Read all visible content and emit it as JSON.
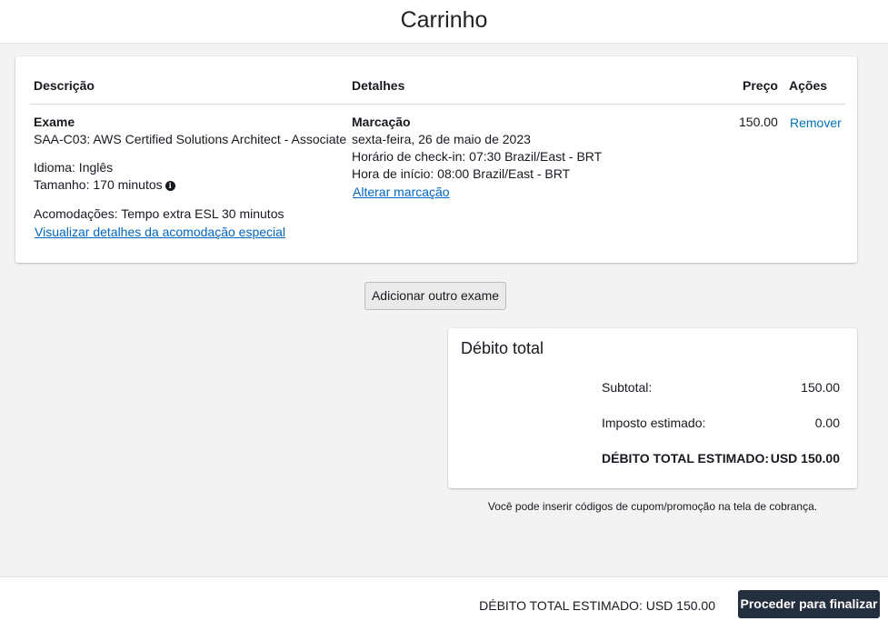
{
  "page": {
    "title": "Carrinho"
  },
  "cart": {
    "columns": {
      "description": "Descrição",
      "details": "Detalhes",
      "price": "Preço",
      "actions": "Ações"
    },
    "item": {
      "type_label": "Exame",
      "exam_name": "SAA-C03: AWS Certified Solutions Architect - Associate",
      "language": "Idioma: Inglês",
      "length": "Tamanho: 170 minutos",
      "length_info_icon": "info-circle-icon",
      "accommodations": "Acomodações: Tempo extra ESL 30 minutos",
      "accommodation_link": "Visualizar detalhes da acomodação especial",
      "booking_label": "Marcação",
      "date": "sexta-feira, 26 de maio de 2023",
      "checkin": "Horário de check-in: 07:30 Brazil/East - BRT",
      "start": "Hora de início: 08:00 Brazil/East - BRT",
      "change_link": "Alterar marcação",
      "price": "150.00",
      "remove": "Remover"
    },
    "add_button": "Adicionar outro exame"
  },
  "total": {
    "title": "Débito total",
    "subtotal_label": "Subtotal:",
    "subtotal_value": "150.00",
    "tax_label": "Imposto estimado:",
    "tax_value": "0.00",
    "estimated_label": "DÉBITO TOTAL ESTIMADO:",
    "estimated_value": "USD 150.00"
  },
  "coupon_note": "Você pode inserir códigos de cupom/promoção na tela de cobrança.",
  "footer": {
    "estimated_total": "DÉBITO TOTAL ESTIMADO: USD 150.00",
    "proceed_button": "Proceder para finalizar"
  },
  "colors": {
    "link": "#0073bb",
    "primary_button": "#232f3e",
    "background": "#f3f3f3"
  }
}
